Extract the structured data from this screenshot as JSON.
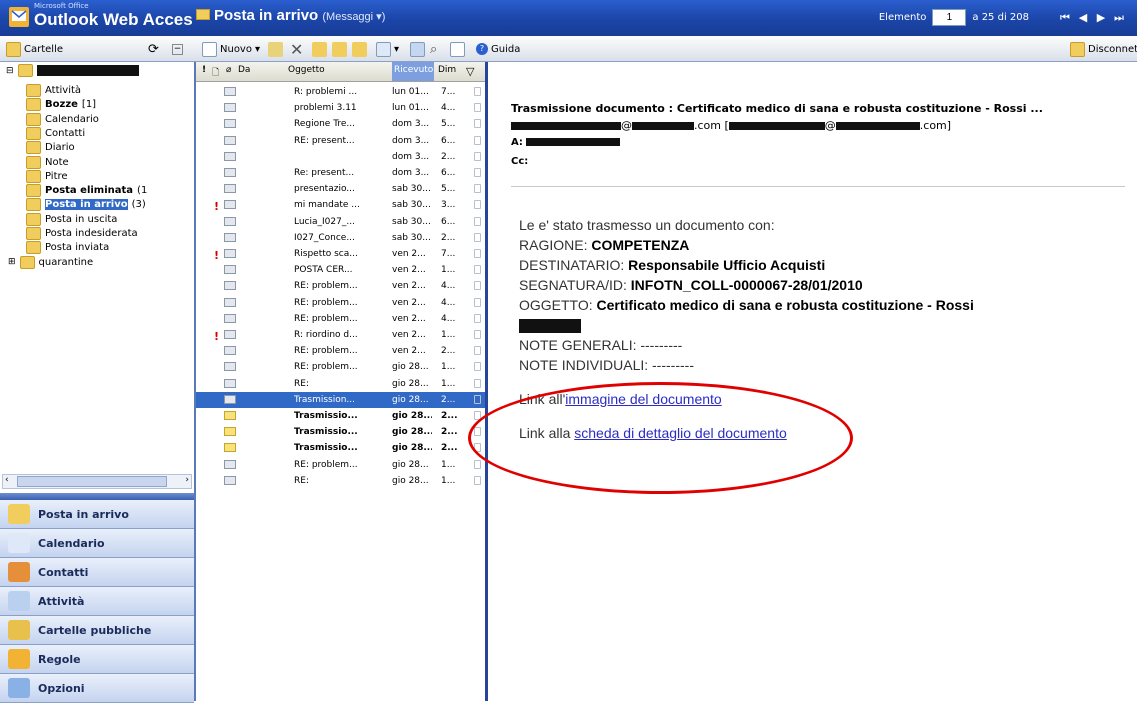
{
  "titlebar": {
    "brand_small": "Microsoft Office",
    "brand": "Outlook Web Acces",
    "folder": "Posta in arrivo",
    "folder_sub": "(Messaggi ▾)",
    "elem_label": "Elemento",
    "elem_value": "1",
    "elem_of": "a 25 di 208"
  },
  "left_toolbar": {
    "label": "Cartelle"
  },
  "toolbar": {
    "new": "Nuovo",
    "guide": "Guida",
    "disconnect": "Disconnetti"
  },
  "tree": {
    "root": "",
    "items": [
      {
        "label": "Attività",
        "bold": false
      },
      {
        "label": "Bozze",
        "count": "[1]",
        "bold": true
      },
      {
        "label": "Calendario",
        "bold": false
      },
      {
        "label": "Contatti",
        "bold": false
      },
      {
        "label": "Diario",
        "bold": false
      },
      {
        "label": "Note",
        "bold": false
      },
      {
        "label": "Pitre",
        "bold": false
      },
      {
        "label": "Posta eliminata",
        "count": "(1",
        "bold": true
      },
      {
        "label": "Posta in arrivo",
        "count": "(3)",
        "bold": true,
        "selected": true
      },
      {
        "label": "Posta in uscita",
        "bold": false
      },
      {
        "label": "Posta indesiderata",
        "bold": false
      },
      {
        "label": "Posta inviata",
        "bold": false
      },
      {
        "label": "quarantine",
        "bold": false
      }
    ]
  },
  "nav": [
    "Posta in arrivo",
    "Calendario",
    "Contatti",
    "Attività",
    "Cartelle pubbliche",
    "Regole",
    "Opzioni"
  ],
  "list": {
    "headers": {
      "from": "Da",
      "subject": "Oggetto",
      "received": "Ricevuto",
      "size": "Dim"
    },
    "rows": [
      {
        "subject": "R: problemi ...",
        "date": "lun 01...",
        "size": "7..."
      },
      {
        "subject": "problemi 3.11",
        "date": "lun 01...",
        "size": "4..."
      },
      {
        "subject": "Regione Tre...",
        "date": "dom 3...",
        "size": "5..."
      },
      {
        "subject": "RE: present...",
        "date": "dom 3...",
        "size": "6..."
      },
      {
        "subject": "",
        "date": "dom 3...",
        "size": "2..."
      },
      {
        "subject": "Re: present...",
        "date": "dom 3...",
        "size": "6..."
      },
      {
        "subject": "presentazio...",
        "date": "sab 30...",
        "size": "5..."
      },
      {
        "subject": "mi mandate ...",
        "date": "sab 30...",
        "size": "3...",
        "imp": true
      },
      {
        "subject": "Lucia_I027_...",
        "date": "sab 30...",
        "size": "6..."
      },
      {
        "subject": "I027_Conce...",
        "date": "sab 30...",
        "size": "2..."
      },
      {
        "subject": "Rispetto sca...",
        "date": "ven 2...",
        "size": "7...",
        "imp": true
      },
      {
        "subject": "POSTA CER...",
        "date": "ven 2...",
        "size": "1..."
      },
      {
        "subject": "RE: problem...",
        "date": "ven 2...",
        "size": "4..."
      },
      {
        "subject": "RE: problem...",
        "date": "ven 2...",
        "size": "4..."
      },
      {
        "subject": "RE: problem...",
        "date": "ven 2...",
        "size": "4..."
      },
      {
        "subject": "R: riordino d...",
        "date": "ven 2...",
        "size": "1...",
        "imp": true
      },
      {
        "subject": "RE: problem...",
        "date": "ven 2...",
        "size": "2..."
      },
      {
        "subject": "RE: problem...",
        "date": "gio 28...",
        "size": "1..."
      },
      {
        "subject": "RE:",
        "date": "gio 28...",
        "size": "1..."
      },
      {
        "subject": "Trasmission...",
        "date": "gio 28...",
        "size": "2...",
        "selected": true
      },
      {
        "subject": "Trasmissio...",
        "date": "gio 28...",
        "size": "2...",
        "bold": true,
        "unread": true
      },
      {
        "subject": "Trasmissio...",
        "date": "gio 28...",
        "size": "2...",
        "bold": true,
        "unread": true
      },
      {
        "subject": "Trasmissio...",
        "date": "gio 28...",
        "size": "2...",
        "bold": true,
        "unread": true
      },
      {
        "subject": "RE: problem...",
        "date": "gio 28...",
        "size": "1..."
      },
      {
        "subject": "RE:",
        "date": "gio 28...",
        "size": "1..."
      }
    ]
  },
  "reading": {
    "subject": "Trasmissione documento : Certificato medico di sana e robusta costituzione - Rossi ...",
    "from_domain1": ".com [",
    "from_domain2": ".com]",
    "to_label": "A:",
    "cc_label": "Cc:",
    "intro": "Le e' stato trasmesso un documento con:",
    "ragione_label": "RAGIONE:",
    "ragione": "COMPETENZA",
    "dest_label": "DESTINATARIO:",
    "dest": "Responsabile Ufficio Acquisti",
    "segn_label": "SEGNATURA/ID:",
    "segn": "INFOTN_COLL-0000067-28/01/2010",
    "ogg_label": "OGGETTO:",
    "ogg": "Certificato medico di sana e robusta costituzione - Rossi",
    "note_gen": "NOTE GENERALI: ---------",
    "note_ind": "NOTE INDIVIDUALI: ---------",
    "link1_prefix": "Link all'",
    "link1": "immagine del documento",
    "link2_prefix": "Link alla ",
    "link2": "scheda di dettaglio del documento"
  },
  "colors": {
    "titlebar": "#1b45a8",
    "selection": "#3169c6",
    "annotation": "#e00000"
  }
}
